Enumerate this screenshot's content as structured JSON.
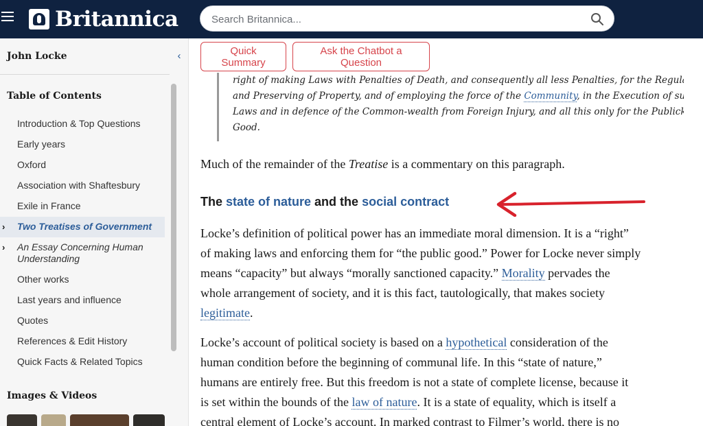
{
  "header": {
    "logo_text": "Britannica",
    "search_placeholder": "Search Britannica..."
  },
  "sidebar": {
    "title": "John Locke",
    "toc_title": "Table of Contents",
    "items": [
      {
        "label": "Introduction & Top Questions"
      },
      {
        "label": "Early years"
      },
      {
        "label": "Oxford"
      },
      {
        "label": "Association with Shaftesbury"
      },
      {
        "label": "Exile in France"
      },
      {
        "label": "Two Treatises of Government",
        "active": true
      },
      {
        "label": "An Essay Concerning Human Understanding"
      },
      {
        "label": "Other works"
      },
      {
        "label": "Last years and influence"
      },
      {
        "label": "Quotes"
      },
      {
        "label": "References & Edit History"
      },
      {
        "label": "Quick Facts & Related Topics"
      }
    ],
    "images_title": "Images & Videos"
  },
  "actions": {
    "quick_summary": "Quick Summary",
    "chatbot": "Ask the Chatbot a Question"
  },
  "article": {
    "quote": {
      "l1": "right of making Laws with Penalties of Death, and consequently all less Penalties, for the Regulating",
      "l2a": "and Preserving of Property, and of employing the force of the ",
      "l2_link": "Community",
      "l2b": ", in the Execution of such",
      "l3": "Laws and in defence of the Common-wealth from Foreign Injury, and all this only for the Publick",
      "l4": "Good."
    },
    "remainder": {
      "a": "Much of the remainder of the ",
      "em": "Treatise",
      "b": " is a commentary on this paragraph."
    },
    "heading": {
      "a": "The ",
      "link1": "state of nature",
      "b": " and the ",
      "link2": "social contract"
    },
    "def": {
      "l1": "Locke’s definition of political power has an immediate moral dimension. It is a “right”",
      "l2": "of making laws and enforcing them for “the public good.” Power for Locke never simply",
      "l3a": "means “capacity” but always “morally sanctioned capacity.” ",
      "l3_link": "Morality",
      "l3b": " pervades the",
      "l4": "whole arrangement of society, and it is this fact, tautologically, that makes society",
      "l5_link": "legitimate",
      "l5b": "."
    },
    "account": {
      "l1a": "Locke’s account of political society is based on a ",
      "l1_link": "hypothetical",
      "l1b": " consideration of the",
      "l2": "human condition before the beginning of communal life. In this “state of nature,”",
      "l3": "humans are entirely free. But this freedom is not a state of complete license, because it",
      "l4a": "is set within the bounds of the ",
      "l4_link": "law of nature",
      "l4b": ". It is a state of equality, which is itself a",
      "l5": "central element of Locke’s account. In marked contrast to Filmer’s world, there is no"
    }
  },
  "colors": {
    "header_bg": "#0f2240",
    "link": "#2c5d99",
    "accent_red": "#d6434a"
  }
}
